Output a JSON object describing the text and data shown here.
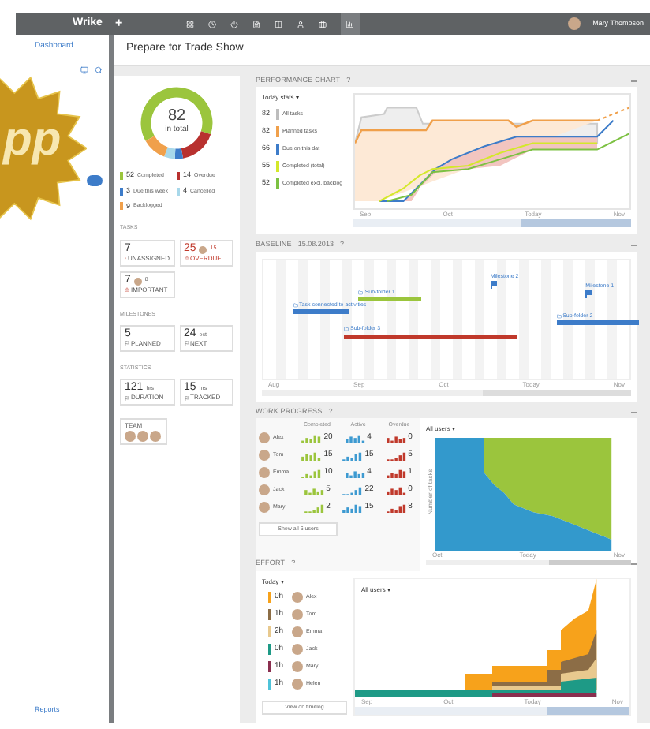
{
  "badge": {
    "text": "pp"
  },
  "topbar": {
    "logo": "Wrike",
    "add": "+",
    "user": "Mary Thompson"
  },
  "sidebar": {
    "items": [
      {
        "label": "Dashboard",
        "selected": false
      }
    ],
    "footer": "Reports"
  },
  "page": {
    "title": "Prepare for Trade Show"
  },
  "summary": {
    "total": "82",
    "total_label": "in total",
    "legend": [
      {
        "count": "52",
        "label": "Completed",
        "color": "#9bc53d"
      },
      {
        "count": "14",
        "label": "Overdue",
        "color": "#b8312f"
      },
      {
        "count": "3",
        "label": "Due this week",
        "color": "#3d7cc9"
      },
      {
        "count": "4",
        "label": "Cancelled",
        "color": "#a8d8ea"
      },
      {
        "count": "9",
        "label": "Backlogged",
        "color": "#f0a04b"
      }
    ],
    "sections": [
      {
        "title": "TASKS",
        "cards": [
          {
            "value": "7",
            "label": "UNASSIGNED",
            "alert": false
          },
          {
            "value": "25",
            "label": "OVERDUE",
            "extra": "15",
            "alert": true
          },
          {
            "value": "7",
            "label": "IMPORTANT",
            "extra": "8",
            "alert": false
          }
        ]
      },
      {
        "title": "MILESTONES",
        "cards": [
          {
            "value": "5",
            "label": "PLANNED",
            "alert": false
          },
          {
            "value": "24",
            "unit": "oct",
            "label": "NEXT",
            "alert": false
          }
        ]
      },
      {
        "title": "STATISTICS",
        "cards": [
          {
            "value": "121",
            "unit": "hrs",
            "label": "DURATION",
            "alert": false
          },
          {
            "value": "15",
            "unit": "hrs",
            "label": "TRACKED",
            "alert": false
          }
        ]
      }
    ],
    "team": {
      "title": "TEAM"
    }
  },
  "performance": {
    "title": "PERFORMANCE CHART",
    "help": "?",
    "selector": "Today stats ▾",
    "stats": [
      {
        "count": "82",
        "label": "All tasks",
        "color": "#bdbdbd"
      },
      {
        "count": "82",
        "label": "Planned tasks",
        "color": "#f0a04b"
      },
      {
        "count": "66",
        "label": "Due on this dat",
        "color": "#3d7cc9"
      },
      {
        "count": "55",
        "label": "Completed (total)",
        "color": "#d4e82a"
      },
      {
        "count": "52",
        "label": "Completed excl. backlog",
        "color": "#7cc142"
      }
    ],
    "axis": [
      "Sep",
      "Oct",
      "Today",
      "Nov"
    ]
  },
  "baseline": {
    "title": "BASELINE",
    "date": "15.08.2013",
    "help": "?",
    "items": [
      {
        "label": "Milestone 2",
        "kind": "milestone",
        "color": "#3d7cc9"
      },
      {
        "label": "Sub-folder 1",
        "kind": "bar",
        "color": "#9bc53d"
      },
      {
        "label": "Milestone 1",
        "kind": "milestone",
        "color": "#3d7cc9"
      },
      {
        "label": "Task connected to activities",
        "kind": "bar",
        "color": "#3d7cc9"
      },
      {
        "label": "Sub-folder 2",
        "kind": "bar",
        "color": "#3d7cc9"
      },
      {
        "label": "Sub-folder 3",
        "kind": "bar",
        "color": "#c0392b"
      }
    ],
    "axis": [
      "Aug",
      "Sep",
      "Oct",
      "Today",
      "Nov"
    ]
  },
  "work": {
    "title": "WORK PROGRESS",
    "help": "?",
    "columns": [
      "Completed",
      "Active",
      "Overdue"
    ],
    "rows": [
      {
        "name": "Alex",
        "completed": "20",
        "active": "4",
        "overdue": "0"
      },
      {
        "name": "Tom",
        "completed": "15",
        "active": "15",
        "overdue": "5"
      },
      {
        "name": "Emma",
        "completed": "10",
        "active": "4",
        "overdue": "1"
      },
      {
        "name": "Jack",
        "completed": "5",
        "active": "22",
        "overdue": "0"
      },
      {
        "name": "Mary",
        "completed": "2",
        "active": "15",
        "overdue": "8"
      }
    ],
    "show_all": "Show all 6 users",
    "chart_filter": "All users ▾",
    "ylabel": "Number of tasks",
    "axis": [
      "Oct",
      "Today",
      "Nov"
    ]
  },
  "effort": {
    "title": "EFFORT",
    "help": "?",
    "selector": "Today ▾",
    "rows": [
      {
        "hours": "0h",
        "name": "Alex",
        "color": "#f7a21b"
      },
      {
        "hours": "1h",
        "name": "Tom",
        "color": "#8c6d46"
      },
      {
        "hours": "2h",
        "name": "Emma",
        "color": "#e8c98e"
      },
      {
        "hours": "0h",
        "name": "Jack",
        "color": "#1e9a86"
      },
      {
        "hours": "1h",
        "name": "Mary",
        "color": "#8a2f4f"
      },
      {
        "hours": "1h",
        "name": "Helen",
        "color": "#4fc3d9"
      }
    ],
    "button": "View on timelog",
    "chart_filter": "All users ▾",
    "axis": [
      "Sep",
      "Oct",
      "Today",
      "Nov"
    ]
  }
}
